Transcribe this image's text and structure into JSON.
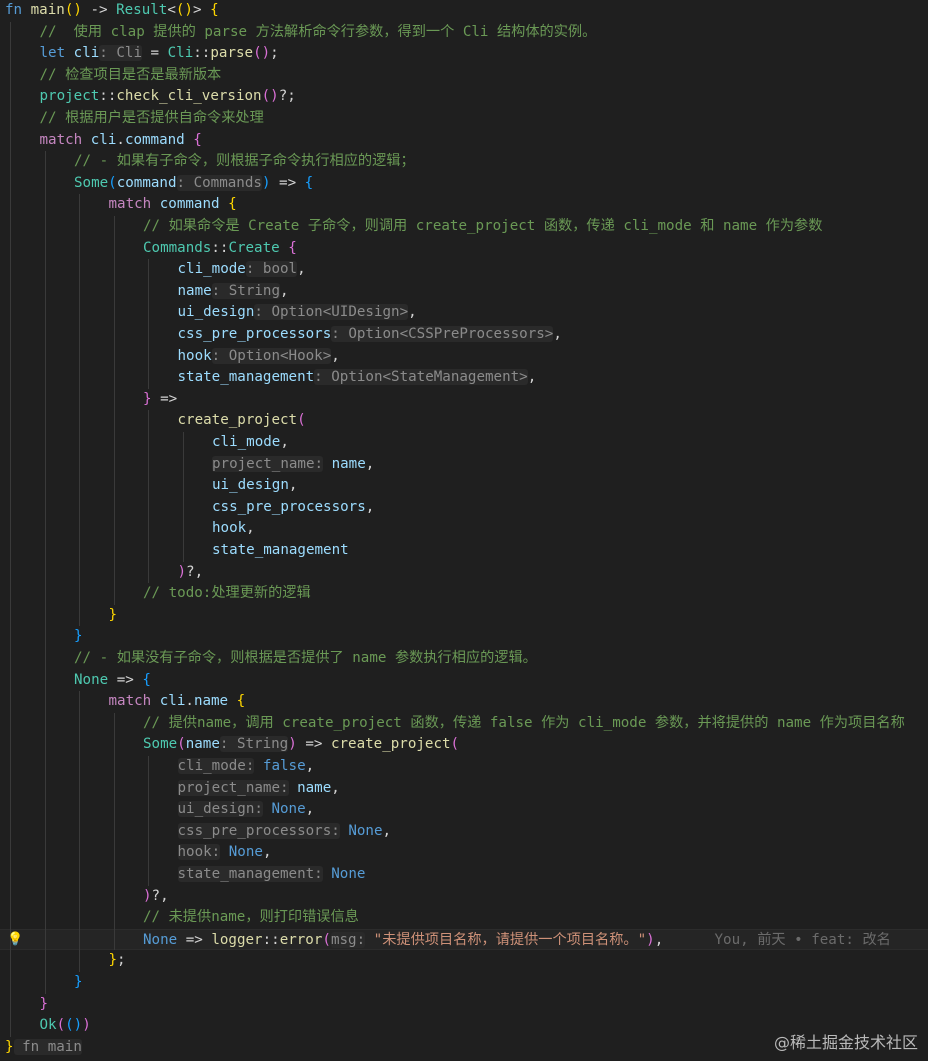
{
  "colors": {
    "background": "#1f1f1f",
    "keyword": "#569cd6",
    "control": "#c586c0",
    "function": "#dcdcaa",
    "type": "#4ec9b0",
    "variable": "#9cdcfe",
    "string": "#ce9178",
    "comment": "#6a9955",
    "inlay_hint": "#8b8b8b"
  },
  "editor": {
    "active_line_index": 43,
    "lightbulb_icon": "lightbulb-icon",
    "lines": [
      {
        "indent": 0,
        "tokens": [
          [
            "kw",
            "fn"
          ],
          [
            "pl",
            " "
          ],
          [
            "fn",
            "main"
          ],
          [
            "br1",
            "()"
          ],
          [
            "pl",
            " -> "
          ],
          [
            "ty",
            "Result"
          ],
          [
            "pl",
            "<"
          ],
          [
            "br1",
            "()"
          ],
          [
            "pl",
            "> "
          ],
          [
            "br1",
            "{"
          ]
        ]
      },
      {
        "indent": 1,
        "tokens": [
          [
            "cm",
            "//  使用 clap 提供的 parse 方法解析命令行参数，得到一个 Cli 结构体的实例。"
          ]
        ]
      },
      {
        "indent": 1,
        "tokens": [
          [
            "kw",
            "let"
          ],
          [
            "pl",
            " "
          ],
          [
            "var",
            "cli"
          ],
          [
            "hint",
            ": Cli"
          ],
          [
            "pl",
            " = "
          ],
          [
            "ty",
            "Cli"
          ],
          [
            "pl",
            "::"
          ],
          [
            "fn",
            "parse"
          ],
          [
            "br2",
            "()"
          ],
          [
            "pl",
            ";"
          ]
        ]
      },
      {
        "indent": 1,
        "tokens": [
          [
            "cm",
            "// 检查项目是否是最新版本"
          ]
        ]
      },
      {
        "indent": 1,
        "tokens": [
          [
            "ty",
            "project"
          ],
          [
            "pl",
            "::"
          ],
          [
            "fn",
            "check_cli_version"
          ],
          [
            "br2",
            "()"
          ],
          [
            "pl",
            "?;"
          ]
        ]
      },
      {
        "indent": 1,
        "tokens": [
          [
            "cm",
            "// 根据用户是否提供自命令来处理"
          ]
        ]
      },
      {
        "indent": 1,
        "tokens": [
          [
            "kwc",
            "match"
          ],
          [
            "pl",
            " "
          ],
          [
            "var",
            "cli"
          ],
          [
            "pl",
            "."
          ],
          [
            "var",
            "command"
          ],
          [
            "pl",
            " "
          ],
          [
            "br2",
            "{"
          ]
        ]
      },
      {
        "indent": 2,
        "tokens": [
          [
            "cm",
            "// - 如果有子命令，则根据子命令执行相应的逻辑；"
          ]
        ]
      },
      {
        "indent": 2,
        "tokens": [
          [
            "ty",
            "Some"
          ],
          [
            "br3",
            "("
          ],
          [
            "var",
            "command"
          ],
          [
            "hint",
            ": Commands"
          ],
          [
            "br3",
            ")"
          ],
          [
            "pl",
            " => "
          ],
          [
            "br3",
            "{"
          ]
        ]
      },
      {
        "indent": 3,
        "tokens": [
          [
            "kwc",
            "match"
          ],
          [
            "pl",
            " "
          ],
          [
            "var",
            "command"
          ],
          [
            "pl",
            " "
          ],
          [
            "br1",
            "{"
          ]
        ]
      },
      {
        "indent": 4,
        "tokens": [
          [
            "cm",
            "// 如果命令是 Create 子命令，则调用 create_project 函数，传递 cli_mode 和 name 作为参数"
          ]
        ]
      },
      {
        "indent": 4,
        "tokens": [
          [
            "ty",
            "Commands"
          ],
          [
            "pl",
            "::"
          ],
          [
            "ty",
            "Create"
          ],
          [
            "pl",
            " "
          ],
          [
            "br2",
            "{"
          ]
        ]
      },
      {
        "indent": 5,
        "tokens": [
          [
            "var",
            "cli_mode"
          ],
          [
            "hint",
            ": bool"
          ],
          [
            "pl",
            ","
          ]
        ]
      },
      {
        "indent": 5,
        "tokens": [
          [
            "var",
            "name"
          ],
          [
            "hint",
            ": String"
          ],
          [
            "pl",
            ","
          ]
        ]
      },
      {
        "indent": 5,
        "tokens": [
          [
            "var",
            "ui_design"
          ],
          [
            "hint",
            ": Option<UIDesign>"
          ],
          [
            "pl",
            ","
          ]
        ]
      },
      {
        "indent": 5,
        "tokens": [
          [
            "var",
            "css_pre_processors"
          ],
          [
            "hint",
            ": Option<CSSPreProcessors>"
          ],
          [
            "pl",
            ","
          ]
        ]
      },
      {
        "indent": 5,
        "tokens": [
          [
            "var",
            "hook"
          ],
          [
            "hint",
            ": Option<Hook>"
          ],
          [
            "pl",
            ","
          ]
        ]
      },
      {
        "indent": 5,
        "tokens": [
          [
            "var",
            "state_management"
          ],
          [
            "hint",
            ": Option<StateManagement>"
          ],
          [
            "pl",
            ","
          ]
        ]
      },
      {
        "indent": 4,
        "tokens": [
          [
            "br2",
            "}"
          ],
          [
            "pl",
            " =>"
          ]
        ]
      },
      {
        "indent": 5,
        "tokens": [
          [
            "fn",
            "create_project"
          ],
          [
            "br2",
            "("
          ]
        ]
      },
      {
        "indent": 6,
        "tokens": [
          [
            "var",
            "cli_mode"
          ],
          [
            "pl",
            ","
          ]
        ]
      },
      {
        "indent": 6,
        "tokens": [
          [
            "hint",
            "project_name:"
          ],
          [
            "pl",
            " "
          ],
          [
            "var",
            "name"
          ],
          [
            "pl",
            ","
          ]
        ]
      },
      {
        "indent": 6,
        "tokens": [
          [
            "var",
            "ui_design"
          ],
          [
            "pl",
            ","
          ]
        ]
      },
      {
        "indent": 6,
        "tokens": [
          [
            "var",
            "css_pre_processors"
          ],
          [
            "pl",
            ","
          ]
        ]
      },
      {
        "indent": 6,
        "tokens": [
          [
            "var",
            "hook"
          ],
          [
            "pl",
            ","
          ]
        ]
      },
      {
        "indent": 6,
        "tokens": [
          [
            "var",
            "state_management"
          ]
        ]
      },
      {
        "indent": 5,
        "tokens": [
          [
            "br2",
            ")"
          ],
          [
            "pl",
            "?,"
          ]
        ]
      },
      {
        "indent": 4,
        "tokens": [
          [
            "cm",
            "// todo:处理更新的逻辑"
          ]
        ]
      },
      {
        "indent": 3,
        "tokens": [
          [
            "br1",
            "}"
          ]
        ]
      },
      {
        "indent": 2,
        "tokens": [
          [
            "br3",
            "}"
          ]
        ]
      },
      {
        "indent": 2,
        "tokens": [
          [
            "cm",
            "// - 如果没有子命令，则根据是否提供了 name 参数执行相应的逻辑。"
          ]
        ]
      },
      {
        "indent": 2,
        "tokens": [
          [
            "ty",
            "None"
          ],
          [
            "pl",
            " => "
          ],
          [
            "br3",
            "{"
          ]
        ]
      },
      {
        "indent": 3,
        "tokens": [
          [
            "kwc",
            "match"
          ],
          [
            "pl",
            " "
          ],
          [
            "var",
            "cli"
          ],
          [
            "pl",
            "."
          ],
          [
            "var",
            "name"
          ],
          [
            "pl",
            " "
          ],
          [
            "br1",
            "{"
          ]
        ]
      },
      {
        "indent": 4,
        "tokens": [
          [
            "cm",
            "// 提供name，调用 create_project 函数，传递 false 作为 cli_mode 参数，并将提供的 name 作为项目名称"
          ]
        ]
      },
      {
        "indent": 4,
        "tokens": [
          [
            "ty",
            "Some"
          ],
          [
            "br2",
            "("
          ],
          [
            "var",
            "name"
          ],
          [
            "hint",
            ": String"
          ],
          [
            "br2",
            ")"
          ],
          [
            "pl",
            " => "
          ],
          [
            "fn",
            "create_project"
          ],
          [
            "br2",
            "("
          ]
        ]
      },
      {
        "indent": 5,
        "tokens": [
          [
            "hint",
            "cli_mode:"
          ],
          [
            "pl",
            " "
          ],
          [
            "kw",
            "false"
          ],
          [
            "pl",
            ","
          ]
        ]
      },
      {
        "indent": 5,
        "tokens": [
          [
            "hint",
            "project_name:"
          ],
          [
            "pl",
            " "
          ],
          [
            "var",
            "name"
          ],
          [
            "pl",
            ","
          ]
        ]
      },
      {
        "indent": 5,
        "tokens": [
          [
            "hint",
            "ui_design:"
          ],
          [
            "pl",
            " "
          ],
          [
            "kw",
            "None"
          ],
          [
            "pl",
            ","
          ]
        ]
      },
      {
        "indent": 5,
        "tokens": [
          [
            "hint",
            "css_pre_processors:"
          ],
          [
            "pl",
            " "
          ],
          [
            "kw",
            "None"
          ],
          [
            "pl",
            ","
          ]
        ]
      },
      {
        "indent": 5,
        "tokens": [
          [
            "hint",
            "hook:"
          ],
          [
            "pl",
            " "
          ],
          [
            "kw",
            "None"
          ],
          [
            "pl",
            ","
          ]
        ]
      },
      {
        "indent": 5,
        "tokens": [
          [
            "hint",
            "state_management:"
          ],
          [
            "pl",
            " "
          ],
          [
            "kw",
            "None"
          ]
        ]
      },
      {
        "indent": 4,
        "tokens": [
          [
            "br2",
            ")"
          ],
          [
            "pl",
            "?,"
          ]
        ]
      },
      {
        "indent": 4,
        "tokens": [
          [
            "cm",
            "// 未提供name，则打印错误信息"
          ]
        ]
      },
      {
        "indent": 4,
        "tokens": [
          [
            "kw",
            "None"
          ],
          [
            "pl",
            " => "
          ],
          [
            "fn",
            "logger"
          ],
          [
            "pl",
            "::"
          ],
          [
            "fn",
            "error"
          ],
          [
            "br2",
            "("
          ],
          [
            "hint",
            "msg:"
          ],
          [
            "pl",
            " "
          ],
          [
            "str",
            "\"未提供项目名称，请提供一个项目名称。\""
          ],
          [
            "br2",
            ")"
          ],
          [
            "pl",
            ","
          ],
          [
            "pl",
            "      "
          ],
          [
            "blame",
            "You, 前天 • feat: 改名"
          ]
        ]
      },
      {
        "indent": 3,
        "tokens": [
          [
            "br1",
            "}"
          ],
          [
            "pl",
            ";"
          ]
        ]
      },
      {
        "indent": 2,
        "tokens": [
          [
            "br3",
            "}"
          ]
        ]
      },
      {
        "indent": 1,
        "tokens": [
          [
            "br2",
            "}"
          ]
        ]
      },
      {
        "indent": 1,
        "tokens": [
          [
            "ty",
            "Ok"
          ],
          [
            "br2",
            "("
          ],
          [
            "br3",
            "()"
          ],
          [
            "br2",
            ")"
          ]
        ]
      },
      {
        "indent": 0,
        "tokens": [
          [
            "br1",
            "}"
          ],
          [
            "hint",
            " fn main"
          ]
        ]
      }
    ]
  },
  "watermark": "@稀土掘金技术社区"
}
